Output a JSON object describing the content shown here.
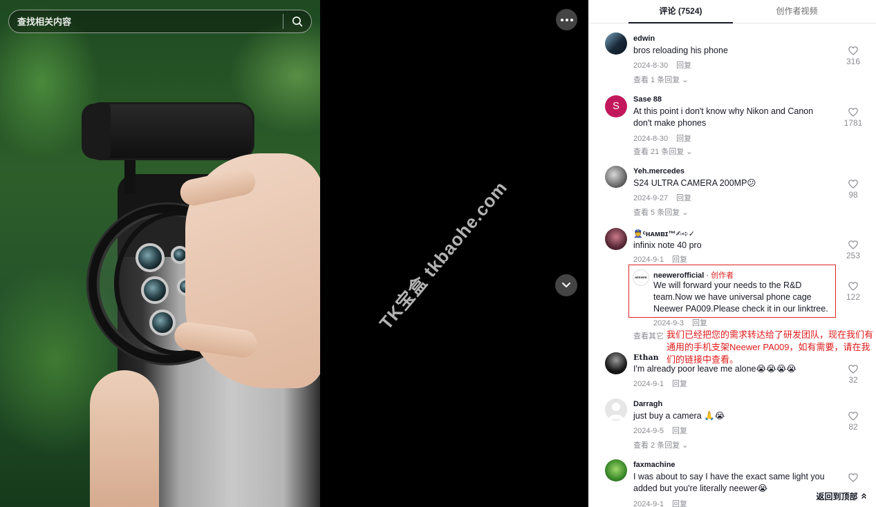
{
  "search": {
    "placeholder": "查找相关内容"
  },
  "video": {
    "watermark": "TK宝盒 tkbaohe.com"
  },
  "tabs": [
    {
      "label": "评论 (7524)",
      "active": true
    },
    {
      "label": "创作者视频",
      "active": false
    }
  ],
  "comments": [
    {
      "user": "edwin",
      "text": "bros reloading his phone",
      "date": "2024-8-30",
      "reply_label": "回复",
      "likes": "316",
      "view_replies": "查看 1 条回复 ⌄"
    },
    {
      "user": "Sase 88",
      "avatar_letter": "S",
      "avatar_color": "#c2185b",
      "text": "At this point i don't know why Nikon and Canon don't make phones",
      "date": "2024-8-30",
      "reply_label": "回复",
      "likes": "1781",
      "view_replies": "查看 21 条回复 ⌄"
    },
    {
      "user": "Yeh.mercedes",
      "text": "S24 ULTRA CAMERA 200MP😕",
      "date": "2024-9-27",
      "reply_label": "回复",
      "likes": "98",
      "view_replies": "查看 5 条回复 ⌄"
    },
    {
      "user": "👮ᶜʜᴀᴍʙɪ™✍︎➪✓",
      "text": "infinix note 40 pro",
      "date": "2024-9-1",
      "reply_label": "回复",
      "likes": "253",
      "view_replies": "查看其它 ⌄"
    },
    {
      "user": "Ethan",
      "text": "I'm already poor leave me alone😭😭😭😭",
      "date": "2024-9-1",
      "reply_label": "回复",
      "likes": "32"
    },
    {
      "user": "Darragh",
      "text": "just buy a camera 🙏😭",
      "date": "2024-9-5",
      "reply_label": "回复",
      "likes": "82",
      "view_replies": "查看 2 条回复 ⌄"
    },
    {
      "user": "faxmachine",
      "text": "I was about to say I have the exact same light you added but you're literally neewer😭",
      "date": "2024-9-1",
      "reply_label": "回复",
      "likes": ""
    }
  ],
  "reply": {
    "user": "neewerofficial",
    "separator": " · ",
    "creator_badge": "创作者",
    "avatar_text": "NEEWER",
    "text": "We will forward your needs to the R&D team.Now we have universal phone cage Neewer PA009.Please check it in our linktree.",
    "date": "2024-9-3",
    "reply_label": "回复",
    "likes": "122"
  },
  "annotation": {
    "text": "我们已经把您的需求转达给了研发团队，现在我们有通用的手机支架Neewer PA009，如有需要，请在我们的链接中查看。"
  },
  "back_to_top": {
    "label": "返回到顶部"
  },
  "colors": {
    "accent_red": "#e02020",
    "text_primary": "#161823",
    "text_secondary": "#8a8b91"
  },
  "icons": [
    "search-icon",
    "more-icon",
    "chevron-down-icon",
    "heart-icon",
    "arrow-up-icon"
  ]
}
